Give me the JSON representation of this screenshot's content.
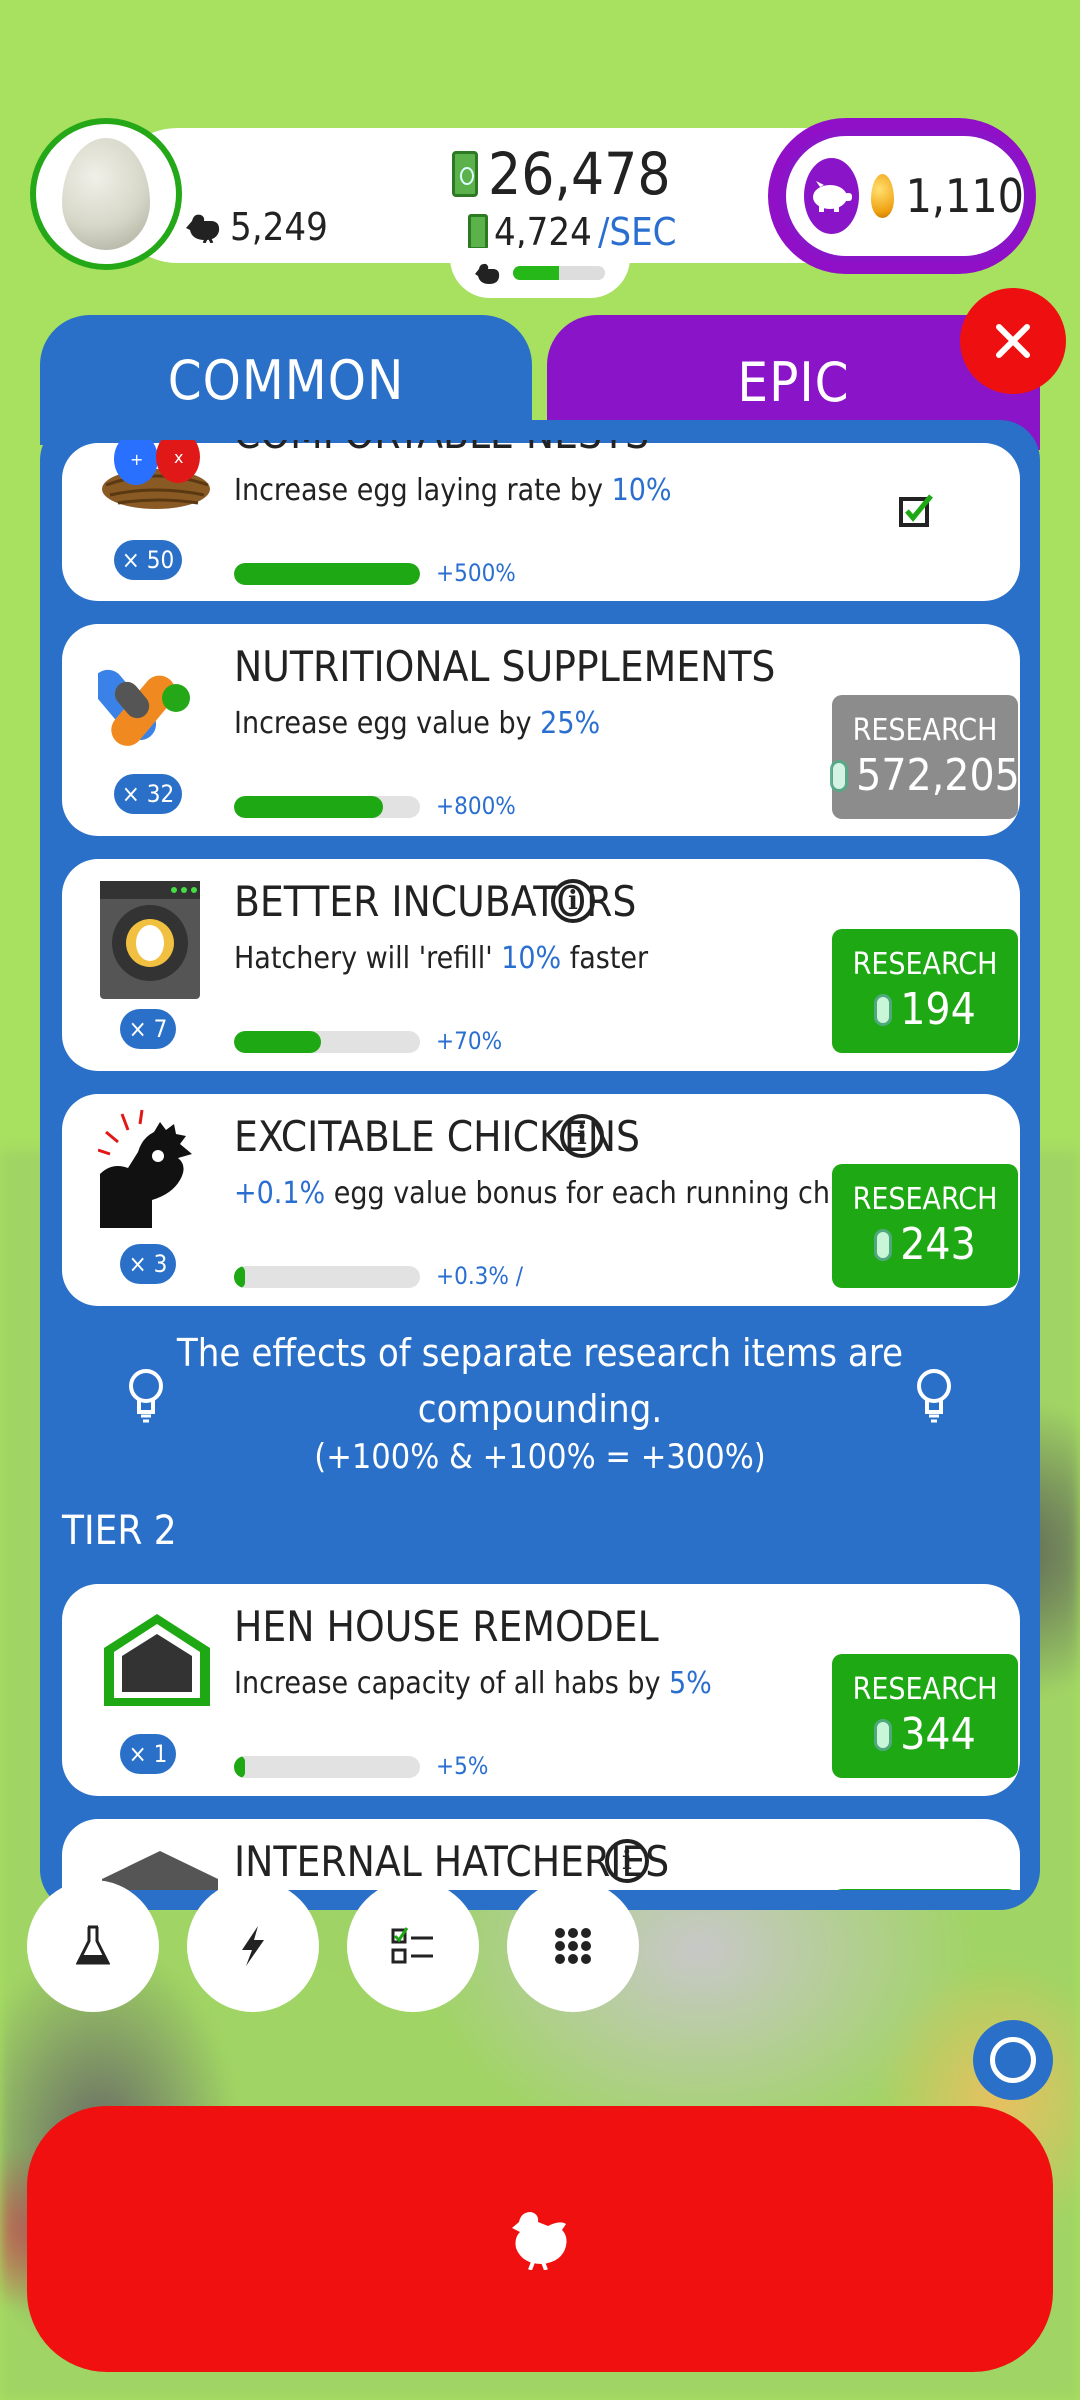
{
  "header": {
    "chickens": "5,249",
    "money": "26,478",
    "rate_value": "4,724",
    "rate_unit": "/SEC",
    "hatchery_fill": 0.5,
    "golden_eggs": "1,110"
  },
  "tabs": {
    "common": "COMMON",
    "epic": "EPIC"
  },
  "colors": {
    "panel_blue": "#2a70c8",
    "epic_purple": "#8a14c8",
    "research_green": "#1ea814",
    "close_red": "#ee1010",
    "background_green": "#a8e060"
  },
  "research_items": [
    {
      "title": "COMFORTABLE NESTS",
      "desc_prefix": "Increase egg laying rate by ",
      "desc_value": "10%",
      "desc_suffix": "",
      "count": "× 50",
      "progress": 1.0,
      "progress_label": "+500%",
      "status": "complete",
      "icon": "nest-icon"
    },
    {
      "title": "NUTRITIONAL SUPPLEMENTS",
      "desc_prefix": "Increase egg value by ",
      "desc_value": "25%",
      "desc_suffix": "",
      "count": "× 32",
      "progress": 0.8,
      "progress_label": "+800%",
      "button_label": "RESEARCH",
      "price": "572,205",
      "button_state": "unaffordable",
      "icon": "pills-icon"
    },
    {
      "title": "BETTER INCUBATORS",
      "desc_prefix": "Hatchery will 'refill' ",
      "desc_value": "10%",
      "desc_suffix": " faster",
      "count": "× 7",
      "progress": 0.47,
      "progress_label": "+70%",
      "button_label": "RESEARCH",
      "price": "194",
      "button_state": "affordable",
      "icon": "incubator-icon"
    },
    {
      "title": "EXCITABLE CHICKENS",
      "desc_prefix": "",
      "desc_value": "+0.1%",
      "desc_suffix": " egg value bonus for each running chicken",
      "count": "× 3",
      "progress": 0.06,
      "progress_label": "+0.3% /",
      "button_label": "RESEARCH",
      "price": "243",
      "button_state": "affordable",
      "icon": "excited-chicken-icon"
    }
  ],
  "tip": {
    "line1": "The effects of separate research items are",
    "line2": "compounding.",
    "line3": "(+100% & +100% = +300%)"
  },
  "tier2": {
    "label": "TIER 2",
    "items": [
      {
        "title": "HEN HOUSE REMODEL",
        "desc_prefix": "Increase capacity of all habs by ",
        "desc_value": "5%",
        "count": "× 1",
        "progress": 0.06,
        "progress_label": "+5%",
        "button_label": "RESEARCH",
        "price": "344",
        "icon": "hen-house-icon"
      },
      {
        "title": "INTERNAL HATCHERIES",
        "icon": "hatchery-icon"
      }
    ]
  },
  "bottom_bar": {
    "buttons": [
      "research-flask-icon",
      "boost-lightning-icon",
      "missions-checklist-icon",
      "menu-grid-icon"
    ]
  }
}
